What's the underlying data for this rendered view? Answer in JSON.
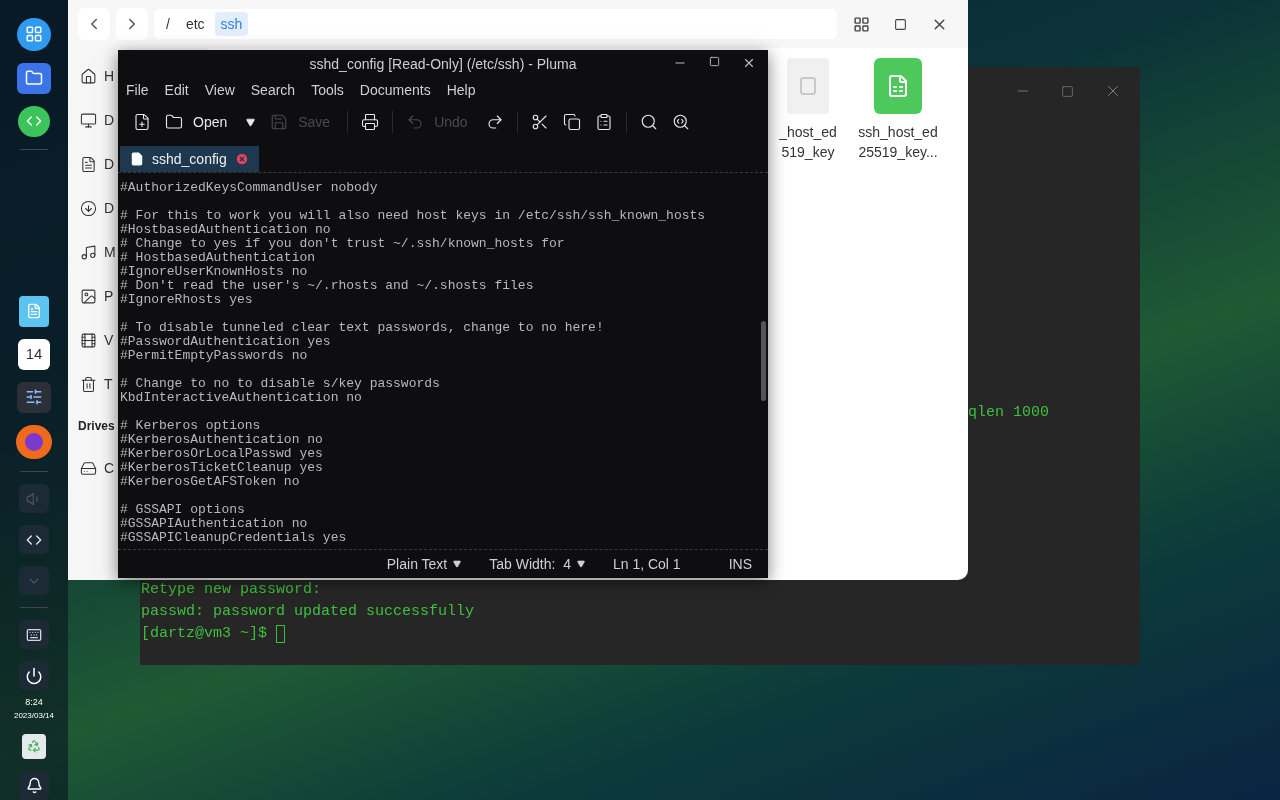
{
  "dock": {
    "top": [
      {
        "kind": "launcher"
      },
      {
        "kind": "files"
      },
      {
        "kind": "green-app"
      }
    ],
    "middle": [
      {
        "kind": "blue-app"
      },
      {
        "kind": "calendar",
        "label": "14"
      },
      {
        "kind": "settings"
      },
      {
        "kind": "browser"
      }
    ],
    "tray": [
      {
        "kind": "speaker"
      },
      {
        "kind": "code"
      },
      {
        "kind": "chevron"
      }
    ],
    "bottom": [
      {
        "kind": "keyboard"
      },
      {
        "kind": "power"
      }
    ],
    "clock": {
      "time": "8:24",
      "date": "2023/03/14"
    },
    "end": [
      {
        "kind": "trash"
      },
      {
        "kind": "bell"
      }
    ]
  },
  "terminal": {
    "lines": [
      {
        "text": "qlen 1000",
        "kind": "offset"
      },
      {
        "text": "Retype new password:",
        "kind": "plain"
      },
      {
        "text": "passwd: password updated successfully",
        "kind": "plain"
      },
      {
        "text": "[dartz@vm3 ~]$ ",
        "kind": "prompt"
      }
    ]
  },
  "file_manager": {
    "breadcrumb": [
      {
        "label": "/",
        "selected": false
      },
      {
        "label": "etc",
        "selected": false
      },
      {
        "label": "ssh",
        "selected": true
      }
    ],
    "sidebar": [
      {
        "kind": "home",
        "label": "H"
      },
      {
        "kind": "desktop",
        "label": "D"
      },
      {
        "kind": "document",
        "label": "D"
      },
      {
        "kind": "download",
        "label": "D"
      },
      {
        "kind": "music",
        "label": "M"
      },
      {
        "kind": "picture",
        "label": "P"
      },
      {
        "kind": "video",
        "label": "V"
      },
      {
        "kind": "trash",
        "label": "T"
      },
      {
        "kind": "heading",
        "label": "Drives"
      },
      {
        "kind": "drive",
        "label": "C"
      }
    ],
    "files": [
      {
        "kind": "binary",
        "lines": [
          "_host_ed",
          "519_key"
        ]
      },
      {
        "kind": "spreadsheet",
        "lines": [
          "ssh_host_ed",
          "25519_key..."
        ]
      }
    ]
  },
  "editor": {
    "title": "sshd_config [Read-Only] (/etc/ssh) - Pluma",
    "menu": [
      "File",
      "Edit",
      "View",
      "Search",
      "Tools",
      "Documents",
      "Help"
    ],
    "toolbar": [
      [
        {
          "kind": "new",
          "disabled": false
        },
        {
          "kind": "open",
          "label": "Open",
          "disabled": false
        },
        {
          "kind": "dropdown",
          "disabled": false
        },
        {
          "kind": "save",
          "label": "Save",
          "disabled": true
        }
      ],
      [
        {
          "kind": "print",
          "disabled": false
        }
      ],
      [
        {
          "kind": "undo",
          "label": "Undo",
          "disabled": true
        },
        {
          "kind": "redo",
          "disabled": false
        }
      ],
      [
        {
          "kind": "cut",
          "disabled": false
        },
        {
          "kind": "copy",
          "disabled": false
        },
        {
          "kind": "paste",
          "disabled": false
        }
      ],
      [
        {
          "kind": "find",
          "disabled": false
        },
        {
          "kind": "replace",
          "disabled": false
        }
      ]
    ],
    "tabs": [
      {
        "label": "sshd_config",
        "selected": true
      }
    ],
    "blocks": [
      [
        "#AuthorizedKeysCommandUser nobody"
      ],
      [
        "# For this to work you will also need host keys in /etc/ssh/ssh_known_hosts",
        "#HostbasedAuthentication no",
        "# Change to yes if you don't trust ~/.ssh/known_hosts for",
        "# HostbasedAuthentication",
        "#IgnoreUserKnownHosts no",
        "# Don't read the user's ~/.rhosts and ~/.shosts files",
        "#IgnoreRhosts yes"
      ],
      [
        "# To disable tunneled clear text passwords, change to no here!",
        "#PasswordAuthentication yes",
        "#PermitEmptyPasswords no"
      ],
      [
        "# Change to no to disable s/key passwords",
        "KbdInteractiveAuthentication no"
      ],
      [
        "# Kerberos options",
        "#KerberosAuthentication no",
        "#KerberosOrLocalPasswd yes",
        "#KerberosTicketCleanup yes",
        "#KerberosGetAFSToken no"
      ],
      [
        "# GSSAPI options",
        "#GSSAPIAuthentication no",
        "#GSSAPICleanupCredentials yes"
      ]
    ],
    "status": [
      {
        "kind": "dropdown",
        "text": "Plain Text"
      },
      {
        "kind": "dropdown",
        "text": "Tab Width:  4"
      },
      {
        "kind": "text",
        "text": "Ln 1, Col 1"
      },
      {
        "kind": "text",
        "text": "INS"
      }
    ]
  }
}
